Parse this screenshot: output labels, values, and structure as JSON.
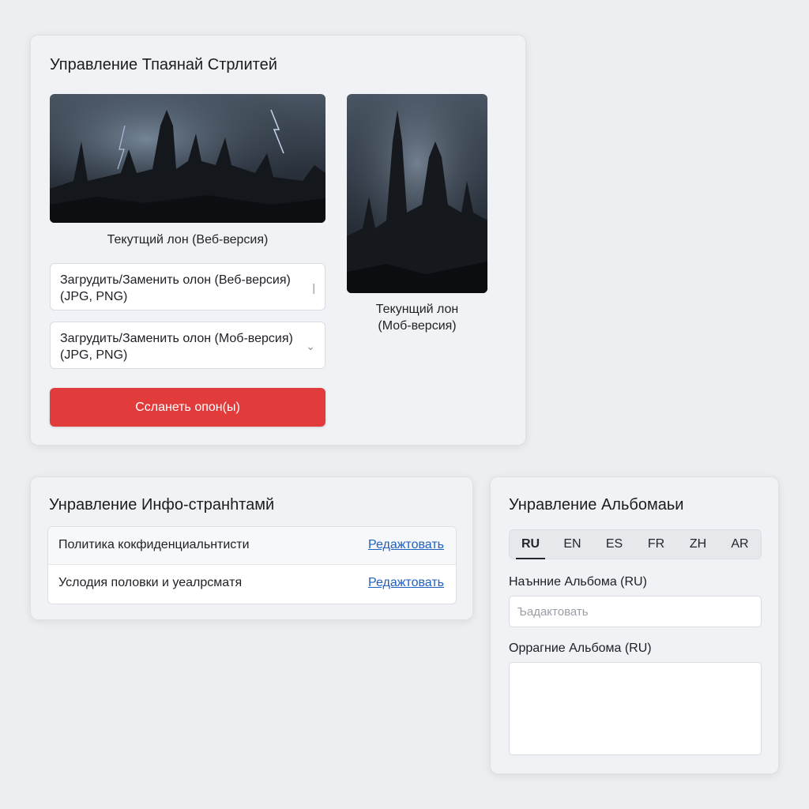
{
  "background_card": {
    "title": "Управление Тпаянай Стрлитей",
    "web_preview_caption": "Текутщий лон (Веб-версия)",
    "mob_preview_caption_line1": "Текунщий лон",
    "mob_preview_caption_line2": "(Моб-версия)",
    "upload_web": {
      "line1": "Загрудить/Заменить олон (Веб-версия)",
      "line2": "(JPG, PNG)",
      "indicator": "|"
    },
    "upload_mob": {
      "line1": "Загрудить/Заменить олон (Моб-версия)",
      "line2": "(JPG, PNG)",
      "indicator": "⌄"
    },
    "save_label": "Ссланеть опон(ы)",
    "save_color": "#e23b3b"
  },
  "info_card": {
    "title": "Унравление Инфо-стрaнhтамй",
    "rows": [
      {
        "name": "Политика кокфиденциальнтисти",
        "action": "Редажтовать"
      },
      {
        "name": "Услодия половки и уеалрсмaтя",
        "action": "Редажтовать"
      }
    ],
    "link_color": "#1f5fbf"
  },
  "album_card": {
    "title": "Унравление Альбомаьи",
    "languages": [
      "RU",
      "EN",
      "ES",
      "FR",
      "ZH",
      "AR"
    ],
    "active_language": "RU",
    "name_label": "Наънние Альбома (RU)",
    "name_placeholder": "Ъадактовать",
    "desc_label": "Оррагние Альбома (RU)",
    "desc_value": ""
  }
}
